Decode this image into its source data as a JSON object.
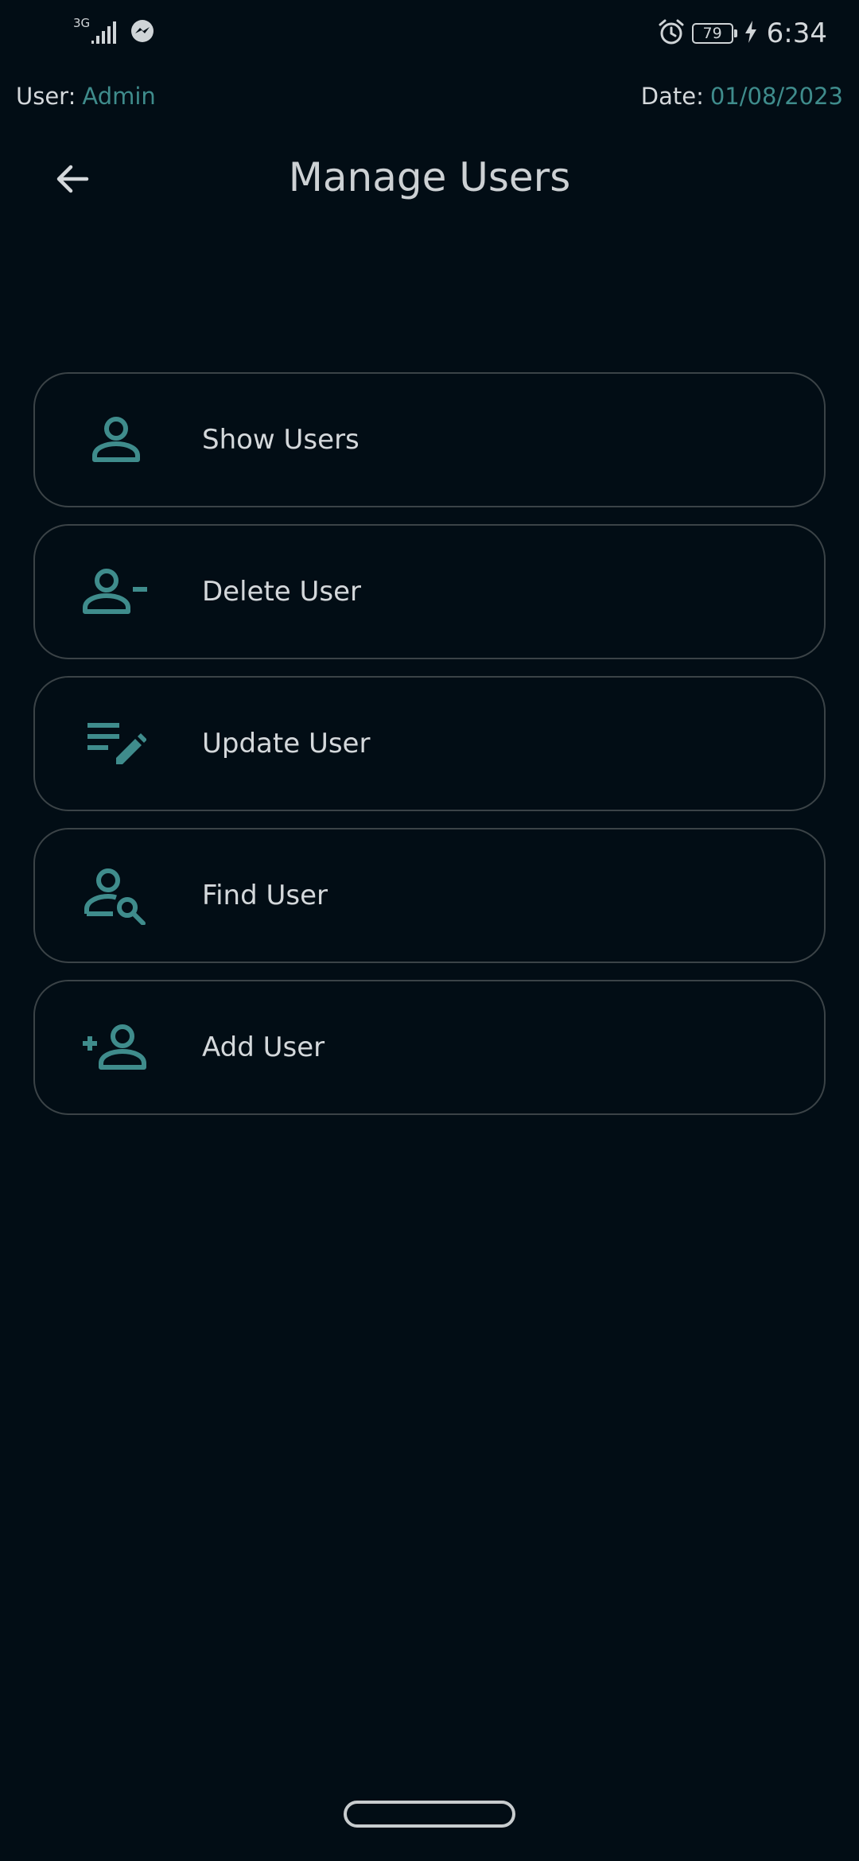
{
  "status_bar": {
    "network_type": "3G",
    "battery_level": "79",
    "time": "6:34",
    "icons": [
      "signal-icon",
      "messenger-icon",
      "alarm-icon",
      "battery-icon",
      "charging-icon"
    ]
  },
  "info": {
    "user_label": "User:",
    "user_value": "Admin",
    "date_label": "Date:",
    "date_value": "01/08/2023"
  },
  "header": {
    "title": "Manage Users",
    "back_icon": "arrow-left-icon"
  },
  "menu": {
    "items": [
      {
        "label": "Show Users",
        "icon": "person-icon"
      },
      {
        "label": "Delete User",
        "icon": "person-remove-icon"
      },
      {
        "label": "Update User",
        "icon": "edit-list-icon"
      },
      {
        "label": "Find User",
        "icon": "person-search-icon"
      },
      {
        "label": "Add User",
        "icon": "person-add-icon"
      }
    ]
  },
  "colors": {
    "background": "#020d15",
    "accent": "#3f8c8c",
    "border": "#3b4347",
    "text": "#d4d8db"
  }
}
